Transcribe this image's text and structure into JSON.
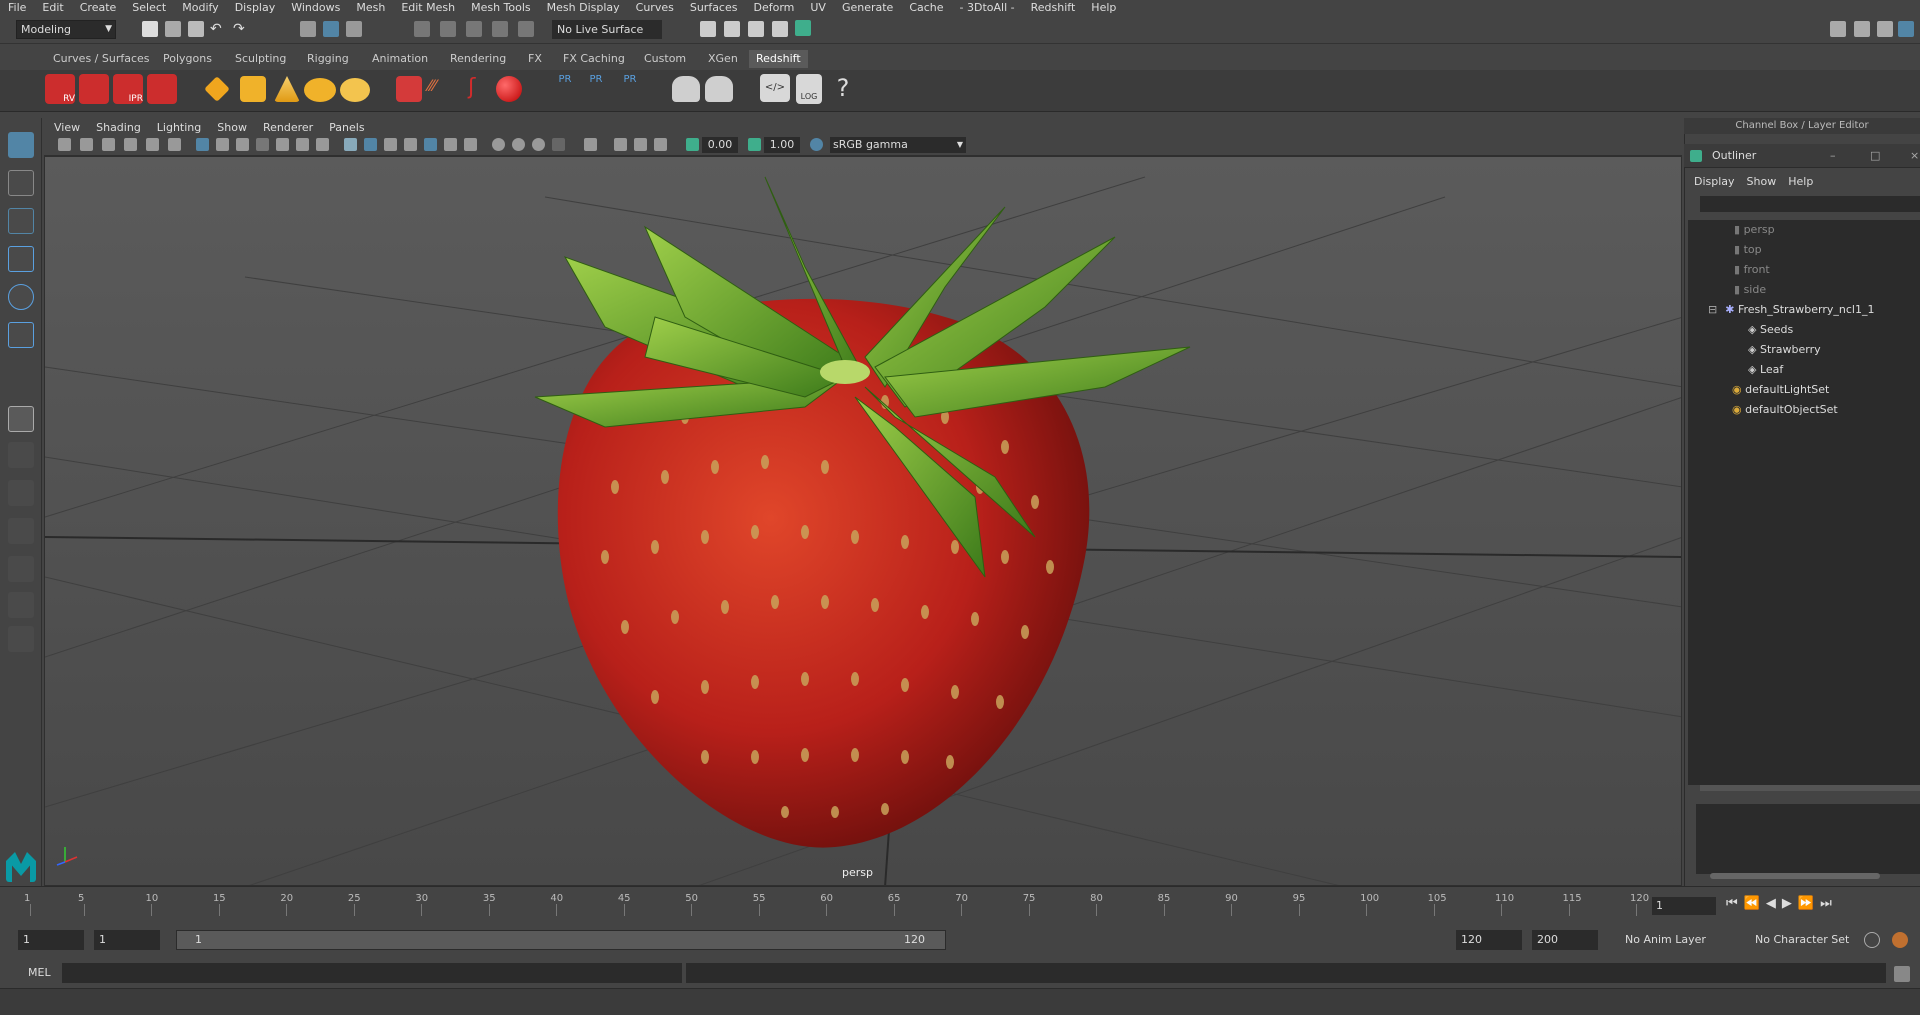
{
  "menubar": [
    "File",
    "Edit",
    "Create",
    "Select",
    "Modify",
    "Display",
    "Windows",
    "Mesh",
    "Edit Mesh",
    "Mesh Tools",
    "Mesh Display",
    "Curves",
    "Surfaces",
    "Deform",
    "UV",
    "Generate",
    "Cache",
    "- 3DtoAll -",
    "Redshift",
    "Help"
  ],
  "status_line": {
    "mode": "Modeling",
    "live_surface": "No Live Surface"
  },
  "shelf_tabs": [
    "Curves / Surfaces",
    "Polygons",
    "Sculpting",
    "Rigging",
    "Animation",
    "Rendering",
    "FX",
    "FX Caching",
    "Custom",
    "XGen",
    "Redshift"
  ],
  "active_shelf": "Redshift",
  "shelf_labels": {
    "rv": "RV",
    "ipr": "IPR",
    "pr1": "PR",
    "pr2": "PR",
    "pr3": "PR",
    "log": "LOG"
  },
  "panel_menu": [
    "View",
    "Shading",
    "Lighting",
    "Show",
    "Renderer",
    "Panels"
  ],
  "panel_toolbar": {
    "exposure": "0.00",
    "gamma": "1.00",
    "color_space": "sRGB gamma"
  },
  "viewport": {
    "camera": "persp"
  },
  "channel_box_title": "Channel Box / Layer Editor",
  "outliner": {
    "title": "Outliner",
    "menu": [
      "Display",
      "Show",
      "Help"
    ],
    "items": [
      {
        "label": "persp",
        "dim": true
      },
      {
        "label": "top",
        "dim": true
      },
      {
        "label": "front",
        "dim": true
      },
      {
        "label": "side",
        "dim": true
      },
      {
        "label": "Fresh_Strawberry_ncl1_1"
      },
      {
        "label": "Seeds"
      },
      {
        "label": "Strawberry"
      },
      {
        "label": "Leaf"
      },
      {
        "label": "defaultLightSet"
      },
      {
        "label": "defaultObjectSet"
      }
    ]
  },
  "timeline": {
    "ticks": [
      "1",
      "5",
      "10",
      "15",
      "20",
      "25",
      "30",
      "35",
      "40",
      "45",
      "50",
      "55",
      "60",
      "65",
      "70",
      "75",
      "80",
      "85",
      "90",
      "95",
      "100",
      "105",
      "110",
      "115",
      "120"
    ],
    "current_frame": "1"
  },
  "range": {
    "start": "1",
    "playback_start": "1",
    "slider_start": "1",
    "slider_end": "120",
    "playback_end": "120",
    "end": "200",
    "anim_layer": "No Anim Layer",
    "character_set": "No Character Set"
  },
  "command_line": {
    "language": "MEL"
  }
}
